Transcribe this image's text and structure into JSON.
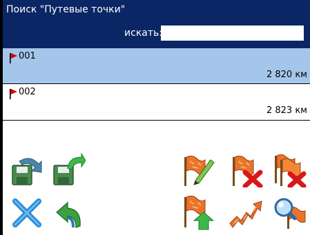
{
  "title": "Поиск \"Путевые точки\"",
  "search": {
    "label": "искать:",
    "value": "",
    "placeholder": ""
  },
  "items": [
    {
      "name": "001",
      "distance": "2 820 км",
      "selected": true,
      "icon": "red-flag-icon"
    },
    {
      "name": "002",
      "distance": "2 823 км",
      "selected": false,
      "icon": "red-flag-icon"
    }
  ],
  "toolbar": {
    "buttons": [
      {
        "id": "save-button",
        "icon": "save-arrow-icon"
      },
      {
        "id": "save-as-button",
        "icon": "save-green-arrow-icon"
      },
      {
        "id": "edit-waypoint-button",
        "icon": "flag-pencil-icon"
      },
      {
        "id": "delete-waypoint-button",
        "icon": "flag-delete-icon"
      },
      {
        "id": "delete-all-waypoints-button",
        "icon": "flags-delete-icon"
      },
      {
        "id": "close-button",
        "icon": "close-x-icon"
      },
      {
        "id": "back-button",
        "icon": "undo-arrow-icon"
      },
      {
        "id": "export-waypoint-button",
        "icon": "flag-up-arrow-icon"
      },
      {
        "id": "route-button",
        "icon": "route-zigzag-icon"
      },
      {
        "id": "find-waypoint-button",
        "icon": "flag-magnifier-icon"
      }
    ]
  },
  "colors": {
    "title_bar": "#0b2665",
    "selection": "#a4c6ea",
    "flag": "#d40000"
  }
}
